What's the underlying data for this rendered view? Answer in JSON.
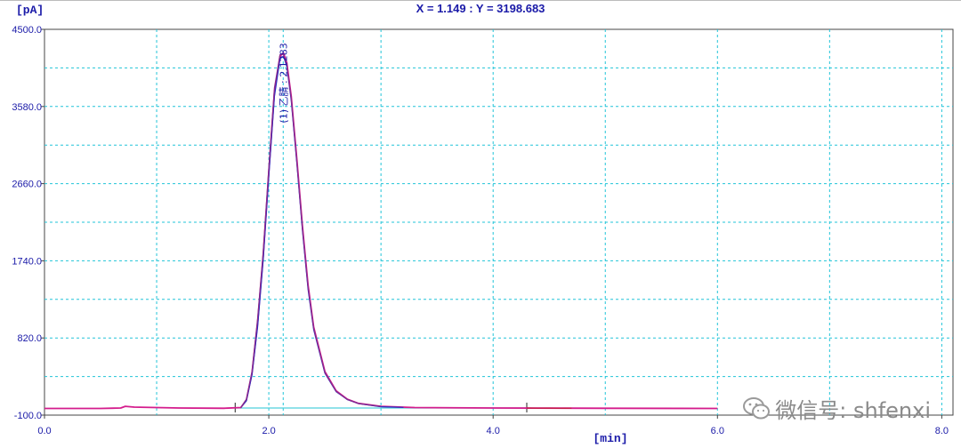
{
  "readout": {
    "text": "X = 1.149 : Y = 3198.683"
  },
  "watermark": {
    "text": "微信号: shfenxi",
    "icon": "wechat-icon"
  },
  "chart_data": {
    "type": "line",
    "xlabel": "[min]",
    "ylabel": "[pA]",
    "xlim": [
      0,
      8.1
    ],
    "ylim": [
      -100,
      4500
    ],
    "xticks": [
      0,
      2,
      4,
      6,
      8
    ],
    "xtick_labels": [
      "0.0",
      "2.0",
      "4.0",
      "6.0",
      "8.0"
    ],
    "yticks": [
      -100,
      820,
      1740,
      2660,
      3580,
      4500
    ],
    "ytick_labels": [
      "-100.0",
      "820.0",
      "1740.0",
      "2660.0",
      "3580.0",
      "4500.0"
    ],
    "grid": true,
    "colors": {
      "axis_text": "#1a1aa8",
      "grid": "#21c4d8",
      "baseline": "#4fd0dc",
      "trace_main": "#d41c8c",
      "trace_alt1": "#2a2ac0",
      "trace_alt2": "#8c2a8c",
      "trace_alt3": "#c01a3a"
    },
    "peak": {
      "label": "(1) 乙腈 : 2.1283",
      "x": 2.1283,
      "y": 4220
    },
    "integration_marks": [
      1.7,
      4.3
    ],
    "series": [
      {
        "color": "#d41c8c",
        "x": [
          0,
          0.5,
          0.68,
          0.72,
          0.8,
          1.2,
          1.6,
          1.75,
          1.8,
          1.85,
          1.9,
          1.95,
          2.0,
          2.05,
          2.1,
          2.13,
          2.16,
          2.2,
          2.25,
          2.3,
          2.35,
          2.4,
          2.5,
          2.6,
          2.7,
          2.8,
          3.0,
          3.3,
          4.0,
          5.0,
          6.0
        ],
        "values": [
          -20,
          -20,
          -15,
          5,
          -5,
          -15,
          -18,
          -10,
          80,
          400,
          1000,
          1800,
          2800,
          3750,
          4180,
          4220,
          4100,
          3700,
          2950,
          2150,
          1450,
          950,
          420,
          190,
          90,
          40,
          5,
          -10,
          -15,
          -18,
          -20
        ]
      },
      {
        "color": "#2a2ac0",
        "x": [
          1.75,
          1.8,
          1.85,
          1.9,
          1.95,
          2.0,
          2.05,
          2.1,
          2.13,
          2.16,
          2.2,
          2.25,
          2.3,
          2.35,
          2.4,
          2.5,
          2.6,
          2.7,
          2.8,
          3.0,
          3.2
        ],
        "values": [
          -10,
          70,
          380,
          950,
          1750,
          2750,
          3700,
          4150,
          4180,
          4060,
          3650,
          2900,
          2100,
          1400,
          920,
          400,
          180,
          85,
          38,
          0,
          -8
        ]
      },
      {
        "color": "#8c2a8c",
        "x": [
          1.75,
          1.8,
          1.85,
          1.9,
          1.95,
          2.0,
          2.05,
          2.1,
          2.13,
          2.16,
          2.2,
          2.25,
          2.3,
          2.35,
          2.4,
          2.5,
          2.6,
          2.7,
          2.8,
          3.0
        ],
        "values": [
          -10,
          90,
          420,
          1050,
          1850,
          2850,
          3800,
          4200,
          4200,
          4080,
          3680,
          2930,
          2130,
          1430,
          940,
          410,
          185,
          88,
          39,
          4
        ]
      },
      {
        "color": "#c01a3a",
        "x": [
          4.3,
          4.4,
          4.5,
          4.6,
          4.7
        ],
        "values": [
          -15,
          -17,
          -16,
          -18,
          -17
        ]
      }
    ]
  }
}
